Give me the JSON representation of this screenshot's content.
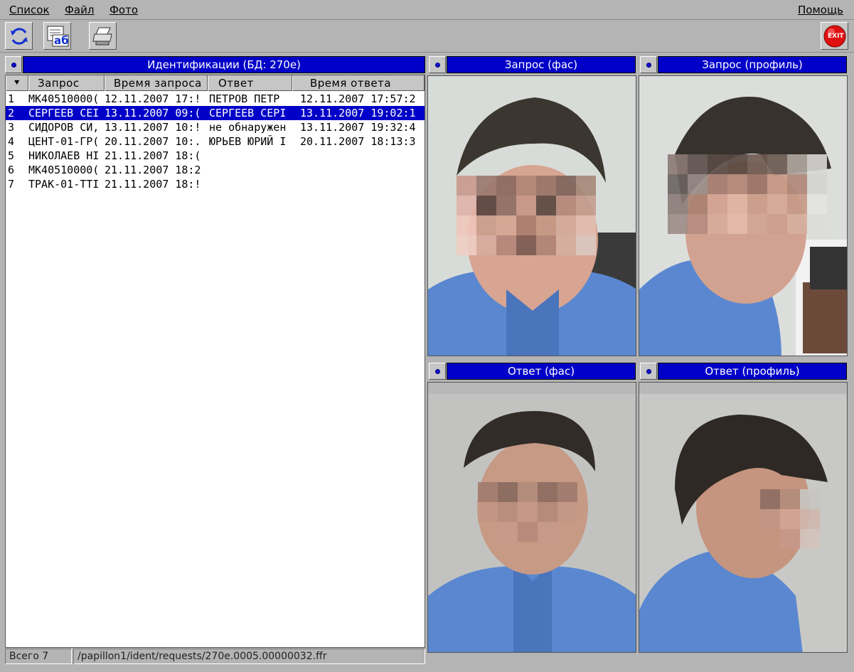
{
  "menu": {
    "list": "Список",
    "file": "Файл",
    "photo": "Фото",
    "help": "Помощь"
  },
  "toolbar": {
    "refresh_icon": "refresh-icon",
    "font_icon_label": "аб",
    "print_icon": "printer-icon",
    "exit_label": "EXIT"
  },
  "list_panel": {
    "title": "Идентификации (БД: 270е)",
    "columns": [
      "Запрос",
      "Время запроса",
      "Ответ",
      "Время ответа"
    ],
    "rows": [
      {
        "n": "1",
        "request": "МК40510000(",
        "req_time": "12.11.2007 17:!",
        "answer": "ПЕТРОВ ПЕТР",
        "ans_time": "12.11.2007 17:57:2"
      },
      {
        "n": "2",
        "request": "СЕРГЕЕВ СЕІ",
        "req_time": "13.11.2007 09:(",
        "answer": "СЕРГЕЕВ СЕРІ",
        "ans_time": "13.11.2007 19:02:1"
      },
      {
        "n": "3",
        "request": "СИДОРОВ СИ,",
        "req_time": "13.11.2007 10:!",
        "answer": "не обнаружен",
        "ans_time": "13.11.2007 19:32:4"
      },
      {
        "n": "4",
        "request": "ЦЕНТ-01-ГР(",
        "req_time": "20.11.2007 10:.",
        "answer": "ЮРЬЕВ ЮРИЙ І",
        "ans_time": "20.11.2007 18:13:3"
      },
      {
        "n": "5",
        "request": "НИКОЛАЕВ НІ",
        "req_time": "21.11.2007 18:(",
        "answer": "",
        "ans_time": ""
      },
      {
        "n": "6",
        "request": "МК40510000(",
        "req_time": "21.11.2007 18:2",
        "answer": "",
        "ans_time": ""
      },
      {
        "n": "7",
        "request": "ТРАК-01-ТТІ",
        "req_time": "21.11.2007 18:!",
        "answer": "",
        "ans_time": ""
      }
    ],
    "selected_row": 1
  },
  "status": {
    "count": "Всего 7",
    "path": "/papillon1/ident/requests/270e.0005.00000032.ffr"
  },
  "photos": {
    "request_front": "Запрос (фас)",
    "request_profile": "Запрос (профиль)",
    "answer_front": "Ответ (фас)",
    "answer_profile": "Ответ (профиль)"
  },
  "colors": {
    "header_blue": "#0000c8",
    "background": "#b4b4b4",
    "shirt": "#5a87d0"
  }
}
